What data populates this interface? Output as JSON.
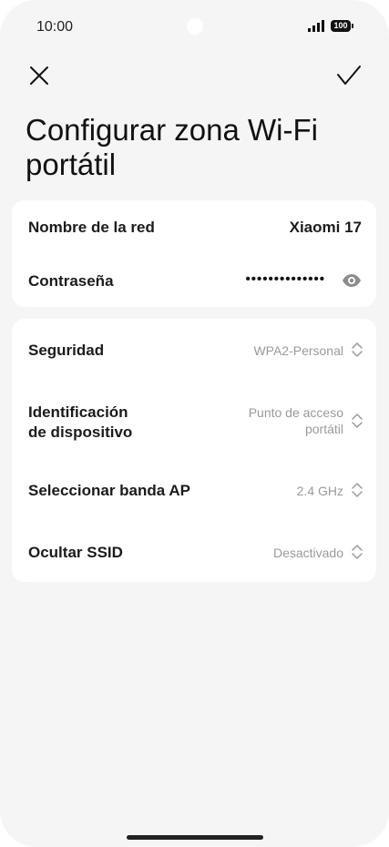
{
  "status_bar": {
    "time": "10:00",
    "battery": "100"
  },
  "header": {
    "title": "Configurar zona Wi-Fi portátil",
    "close_icon": "close-icon",
    "confirm_icon": "check-icon"
  },
  "network_card": {
    "name_label": "Nombre de la red",
    "name_value": "Xiaomi 17",
    "password_label": "Contraseña",
    "password_masked": "••••••••••••••",
    "visibility_icon": "eye-icon"
  },
  "settings": {
    "security": {
      "label": "Seguridad",
      "value": "WPA2-Personal"
    },
    "device_id": {
      "label_line1": "Identificación",
      "label_line2": "de dispositivo",
      "value_line1": "Punto de acceso",
      "value_line2": "portátil"
    },
    "band": {
      "label": "Seleccionar banda AP",
      "value": "2.4 GHz"
    },
    "hide_ssid": {
      "label": "Ocultar SSID",
      "value": "Desactivado"
    }
  }
}
